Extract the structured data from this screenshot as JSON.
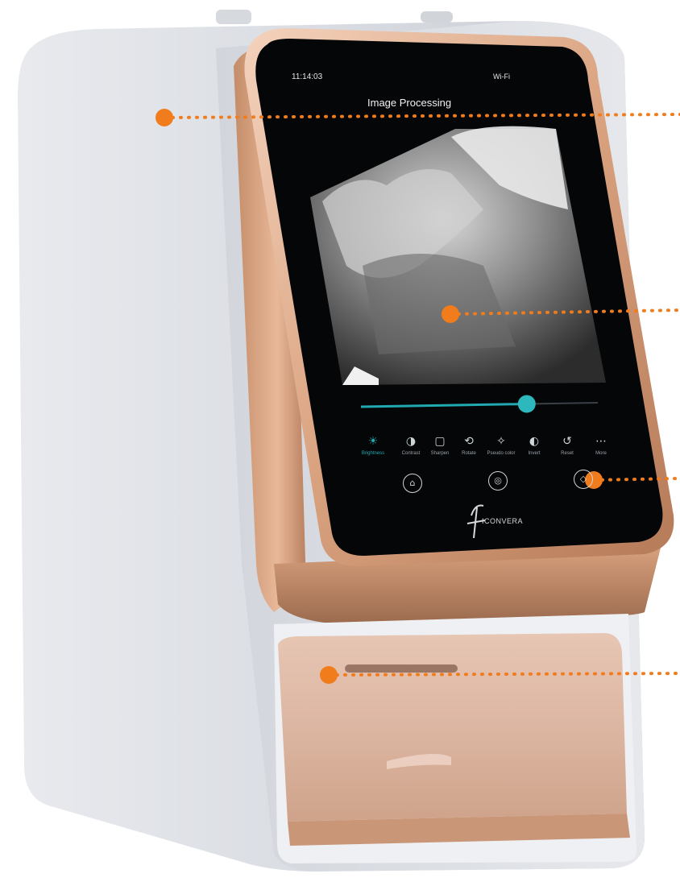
{
  "screen": {
    "status_left": "11:14:03",
    "status_right": "Wi-Fi",
    "title": "Image Processing",
    "slider_value": 0.7
  },
  "tools": [
    {
      "label": "Brightness",
      "icon": "brightness-icon",
      "active": true
    },
    {
      "label": "Contrast",
      "icon": "contrast-icon",
      "active": false
    },
    {
      "label": "Sharpen",
      "icon": "sharpen-icon",
      "active": false
    },
    {
      "label": "Rotate",
      "icon": "rotate-icon",
      "active": false
    },
    {
      "label": "Pseudo color",
      "icon": "pseudo-color-icon",
      "active": false
    },
    {
      "label": "Invert",
      "icon": "invert-icon",
      "active": false
    },
    {
      "label": "Reset",
      "icon": "reset-icon",
      "active": false
    },
    {
      "label": "More",
      "icon": "more-icon",
      "active": false
    }
  ],
  "nav": [
    "home-icon",
    "scan-icon",
    "gallery-icon"
  ],
  "brand": "ICONVERA",
  "colors": {
    "accent": "#20a9b1",
    "callout": "#f07c1c",
    "bezel": "#d8a98a",
    "body": "#dfe2e6"
  }
}
